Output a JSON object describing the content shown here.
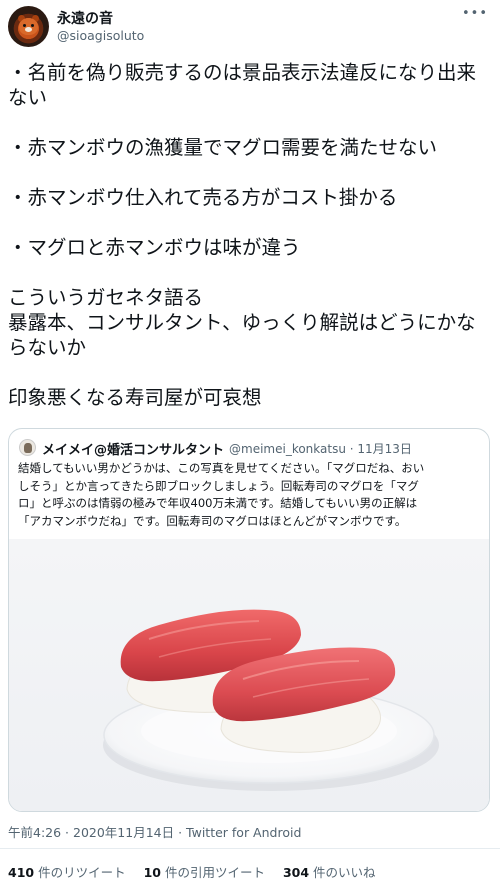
{
  "author": {
    "display_name": "永遠の音",
    "handle": "@sioagisoluto",
    "avatar_icon": "red-panda-avatar",
    "more_icon": "more-options-icon"
  },
  "tweet": {
    "lines": [
      "・名前を偽り販売するのは景品表示法違反になり出来",
      "ない",
      "",
      "・赤マンボウの漁獲量でマグロ需要を満たせない",
      "",
      "・赤マンボウ仕入れて売る方がコスト掛かる",
      "",
      "・マグロと赤マンボウは味が違う",
      "",
      "こういうガセネタ語る",
      "暴露本、コンサルタント、ゆっくり解説はどうにかな",
      "らないか",
      "",
      "印象悪くなる寿司屋が可哀想"
    ]
  },
  "quoted": {
    "display_name": "メイメイ@婚活コンサルタント",
    "handle_date": "@meimei_konkatsu · 11月13日",
    "lines": [
      "結婚してもいい男かどうかは、この写真を見せてください。「マグロだね、おい",
      "しそう」とか言ってきたら即ブロックしましょう。回転寿司のマグロを「マグ",
      "ロ」と呼ぶのは情弱の極みで年収400万未満です。結婚してもいい男の正解は",
      "「アカマンボウだね」です。回転寿司のマグロはほとんどがマンボウです。"
    ],
    "image_subject": "two-tuna-nigiri-on-plate"
  },
  "meta": {
    "timestamp": "午前4:26 · 2020年11月14日 · Twitter for Android"
  },
  "stats": {
    "retweets_num": "410",
    "retweets_label": " 件のリツイート",
    "quotes_num": "10",
    "quotes_label": " 件の引用ツイート",
    "likes_num": "304",
    "likes_label": " 件のいいね"
  },
  "colors": {
    "text": "#0f1419",
    "secondary": "#536471",
    "border": "#cfd9de",
    "tuna": "#d9454a",
    "rice": "#f7f5f0"
  }
}
